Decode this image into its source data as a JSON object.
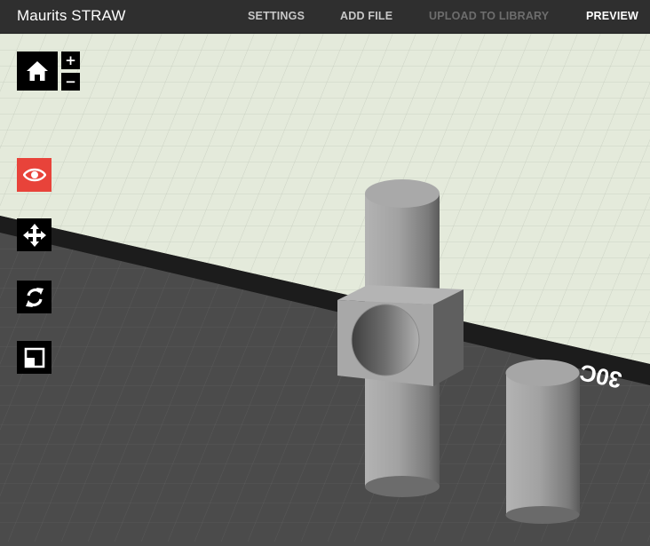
{
  "app": {
    "title": "Maurits STRAW"
  },
  "nav": {
    "settings": "SETTINGS",
    "add_file": "ADD FILE",
    "upload": "UPLOAD TO LIBRARY",
    "preview": "PREVIEW"
  },
  "toolbar": {
    "zoom_in": "+",
    "zoom_out": "−",
    "icons": [
      "home-icon",
      "eye-icon",
      "move-icon",
      "rotate-icon",
      "scale-icon"
    ],
    "active_tool_color": "#e8433a"
  },
  "scene": {
    "platform_label": "30C"
  },
  "colors": {
    "topbar": "#2f2f2f",
    "bed": "#e4eadb",
    "floor": "#4b4b4b",
    "model": "#9a9a9a"
  }
}
